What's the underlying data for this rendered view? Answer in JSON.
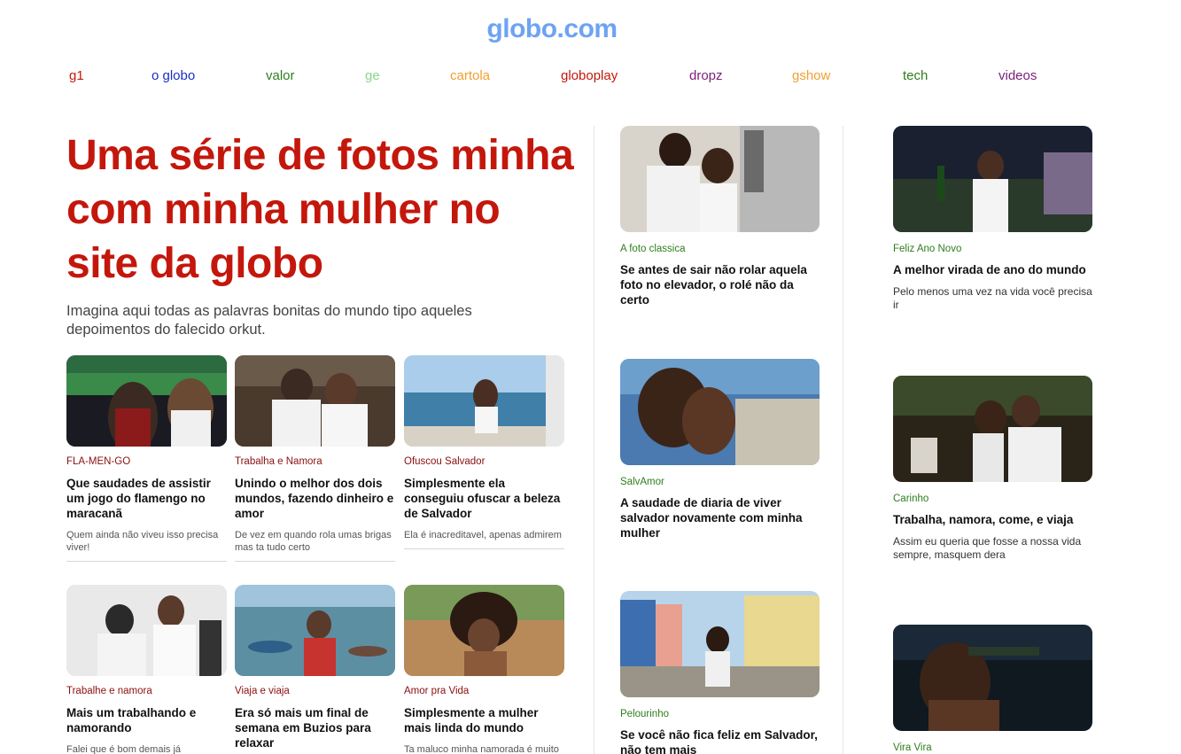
{
  "site": {
    "logo": "globo.com"
  },
  "nav": [
    {
      "label": "g1",
      "color": "#c4170c"
    },
    {
      "label": "o globo",
      "color": "#1a2fc4"
    },
    {
      "label": "valor",
      "color": "#2e7d1d"
    },
    {
      "label": "ge",
      "color": "#8ad68a"
    },
    {
      "label": "cartola",
      "color": "#f0a030"
    },
    {
      "label": "globoplay",
      "color": "#c4170c"
    },
    {
      "label": "dropz",
      "color": "#7a1f7a"
    },
    {
      "label": "gshow",
      "color": "#f0a030"
    },
    {
      "label": "tech",
      "color": "#2e7d1d"
    },
    {
      "label": "videos",
      "color": "#7a1f7a"
    }
  ],
  "hero": {
    "title": "Uma série de fotos minha com minha mulher no site da globo",
    "subtitle": "Imagina aqui todas as palavras bonitas do mundo tipo aqueles depoimentos do falecido orkut."
  },
  "grid_cards": [
    {
      "kicker": "FLA-MEN-GO",
      "title": "Que saudades de assistir um jogo do flamengo no maracanã",
      "desc": "Quem ainda não viveu isso precisa viver!",
      "image": "stadium-photo"
    },
    {
      "kicker": "Trabalha e Namora",
      "title": "Unindo o melhor dos dois mundos, fazendo dinheiro e amor",
      "desc": "De vez em quando rola umas brigas mas ta tudo certo",
      "image": "couple-white-outfits-photo"
    },
    {
      "kicker": "Ofuscou Salvador",
      "title": "Simplesmente ela conseguiu ofuscar a beleza de Salvador",
      "desc": "Ela é inacreditavel, apenas admirem",
      "image": "woman-bay-view-photo"
    },
    {
      "kicker": "Trabalhe e namora",
      "title": "Mais um trabalhando e namorando",
      "desc": "Falei que é bom demais já",
      "image": "couple-studio-photo"
    },
    {
      "kicker": "Viaja e viaja",
      "title": "Era só mais um final de semana em Buzios para relaxar",
      "desc": "",
      "image": "woman-boats-photo"
    },
    {
      "kicker": "Amor pra Vida",
      "title": "Simplesmente a mulher mais linda do mundo",
      "desc": "Ta maluco minha namorada é muito",
      "image": "woman-drink-photo"
    }
  ],
  "middle_column": [
    {
      "kicker": "A foto classica",
      "title": "Se antes de sair não rolar aquela foto no elevador, o rolé não da certo",
      "desc": "",
      "image": "elevador-selfie-photo"
    },
    {
      "kicker": "SalvAmor",
      "title": "A saudade de diaria de viver salvador novamente com minha mulher",
      "desc": "",
      "image": "kiss-salvador-photo"
    },
    {
      "kicker": "Pelourinho",
      "title": "Se você não fica feliz em Salvador, não tem mais",
      "desc": "",
      "image": "pelourinho-street-photo"
    }
  ],
  "right_column": [
    {
      "kicker": "Feliz Ano Novo",
      "title": "A melhor virada de ano do mundo",
      "desc": "Pelo menos uma vez na vida você precisa ir",
      "image": "new-year-party-photo"
    },
    {
      "kicker": "Carinho",
      "title": "Trabalha, namora, come, e viaja",
      "desc": "Assim eu queria que fosse a nossa vida sempre, masquem dera",
      "image": "couple-dinner-photo"
    },
    {
      "kicker": "Vira Vira",
      "title": "",
      "desc": "",
      "image": "woman-bottle-night-photo"
    }
  ]
}
